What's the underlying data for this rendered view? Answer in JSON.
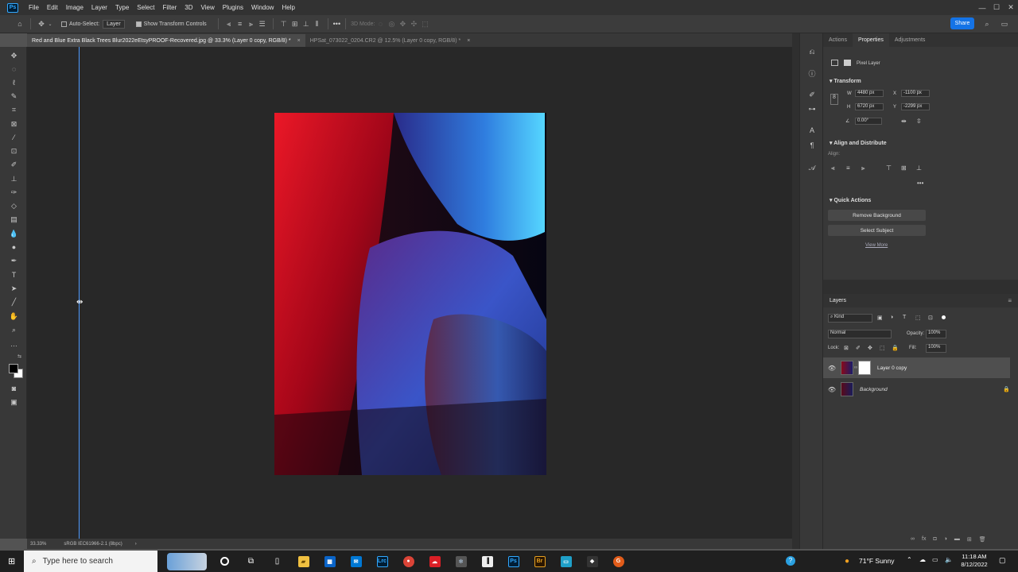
{
  "menu": {
    "logo": "Ps",
    "items": [
      "File",
      "Edit",
      "Image",
      "Layer",
      "Type",
      "Select",
      "Filter",
      "3D",
      "View",
      "Plugins",
      "Window",
      "Help"
    ]
  },
  "window_controls": {
    "minimize": "—",
    "maximize": "☐",
    "close": "✕"
  },
  "options_bar": {
    "auto_select_label": "Auto-Select:",
    "auto_select_value": "Layer",
    "show_transform_label": "Show Transform Controls",
    "mode_3d": "3D Mode:",
    "more": "•••",
    "share_label": "Share"
  },
  "tabs": [
    {
      "label": "Red and Blue Extra Black Trees Blur2022eEtsyPROOF-Recovered.jpg @ 33.3% (Layer 0 copy, RGB/8) *",
      "close": "×"
    },
    {
      "label": "HPSat_073022_0204.CR2 @ 12.5% (Layer 0 copy, RGB/8) *",
      "close": "×"
    }
  ],
  "status": {
    "zoom": "33.33%",
    "profile": "sRGB IEC61966-2.1 (8bpc)",
    "arrow": "›"
  },
  "properties": {
    "tabs": [
      "Actions",
      "Properties",
      "Adjustments"
    ],
    "layer_type": "Pixel Layer",
    "transform": {
      "title": "Transform",
      "w_label": "W",
      "w": "4480 px",
      "x_label": "X",
      "x": "-1100 px",
      "h_label": "H",
      "h": "6720 px",
      "y_label": "Y",
      "y": "-2299 px",
      "angle": "0.00°"
    },
    "align": {
      "title": "Align and Distribute",
      "sub": "Align:",
      "more": "•••"
    },
    "quick": {
      "title": "Quick Actions",
      "remove_bg": "Remove Background",
      "select_subject": "Select Subject",
      "view_more": "View More"
    }
  },
  "layers": {
    "title": "Layers",
    "kind": "Kind",
    "blend": "Normal",
    "opacity_label": "Opacity:",
    "opacity": "100%",
    "lock_label": "Lock:",
    "fill_label": "Fill:",
    "fill": "100%",
    "items": [
      {
        "name": "Layer 0 copy"
      },
      {
        "name": "Background"
      }
    ]
  },
  "taskbar": {
    "search_placeholder": "Type here to search",
    "weather": "71°F  Sunny",
    "time": "11:18 AM",
    "date": "8/12/2022"
  },
  "icons": {
    "move": "move-tool-icon",
    "brush": "brush-icon",
    "eye": "eye-icon",
    "lock": "lock-icon"
  }
}
